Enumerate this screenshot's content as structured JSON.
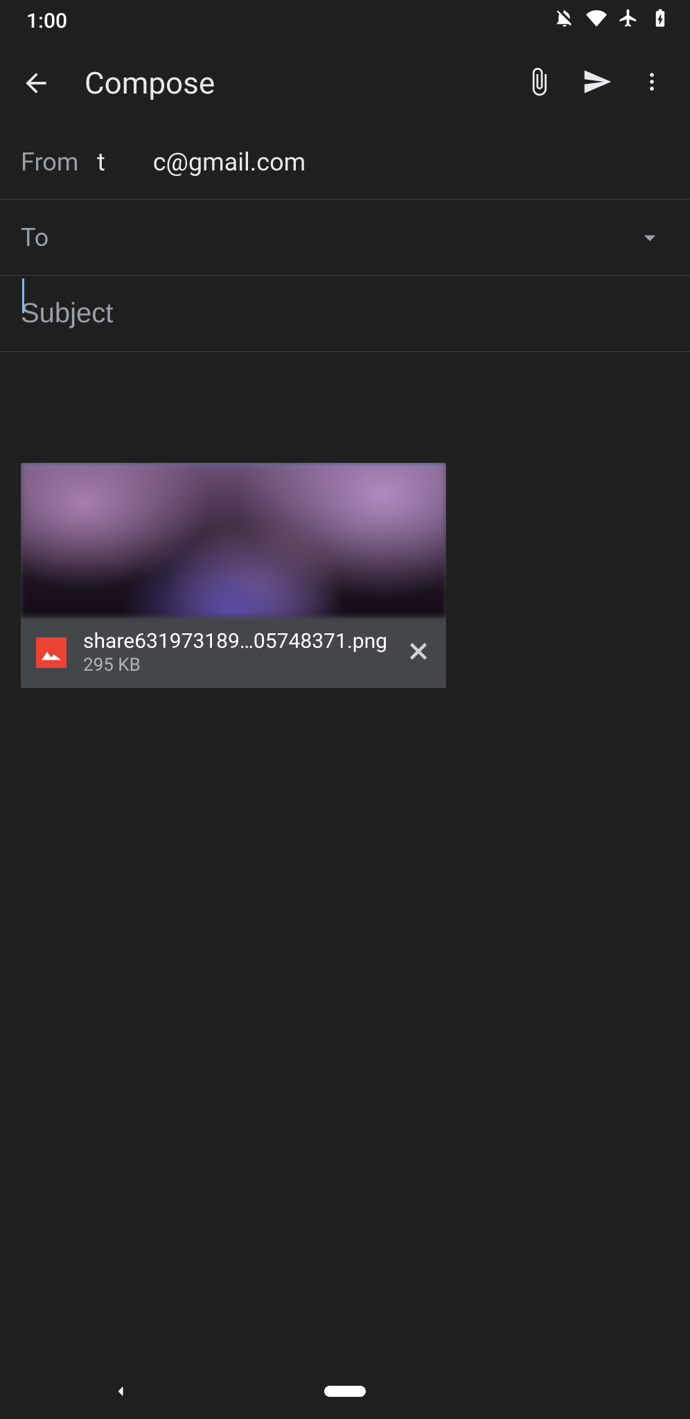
{
  "status": {
    "time": "1:00"
  },
  "appbar": {
    "title": "Compose"
  },
  "fields": {
    "from_label": "From",
    "from_value": "t c@gmail.com",
    "to_label": "To",
    "subject_placeholder": "Subject"
  },
  "attachment": {
    "filename": "share631973189…05748371.png",
    "size": "295 KB"
  }
}
